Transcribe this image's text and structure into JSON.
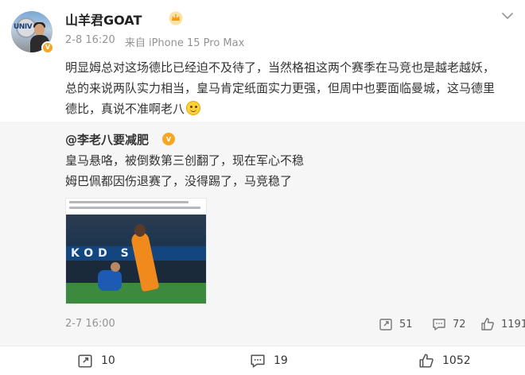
{
  "post": {
    "username": "山羊君GOAT",
    "date": "2-8 16:20",
    "device": "来自 iPhone 15 Pro Max",
    "text_lines": [
      "明显姆总对这场德比已经迫不及待了，当然格祖这两个赛季在马竞也是越老越妖，",
      "总的来说两队实力相当，皇马肯定纸面实力更强，但周中也要面临曼城，这马德里",
      "德比，真说不准啊老八"
    ]
  },
  "repost": {
    "author": "@李老八要减肥",
    "text_lines": [
      "皇马悬咯，被倒数第三创翻了，现在军心不稳",
      "姆巴佩都因伤退赛了，没得踢了，马竞稳了"
    ],
    "image_banner": "KOD  S",
    "date": "2-7 16:00",
    "shares": "51",
    "comments": "72",
    "likes": "1191"
  },
  "actions": {
    "shares": "10",
    "comments": "19",
    "likes": "1052"
  },
  "colors": {
    "accent": "#f6a623",
    "meta_gray": "#939393",
    "repost_bg": "#f6f6f6",
    "text": "#333333"
  },
  "icons": {
    "badge": "v-verified-icon",
    "crown": "crown-icon",
    "menu": "chevron-down-icon",
    "emoji": "smile-icon",
    "share": "share-icon",
    "comment": "comment-icon",
    "like": "thumbs-up-icon"
  }
}
